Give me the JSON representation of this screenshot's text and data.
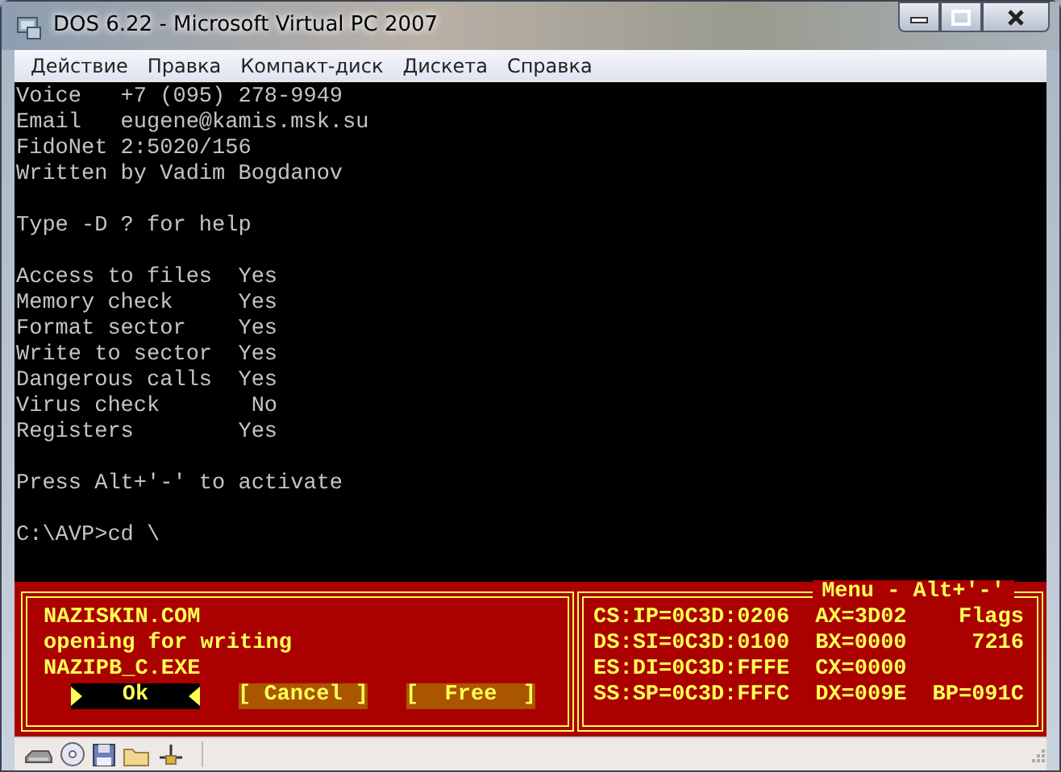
{
  "window": {
    "title": "DOS 6.22 - Microsoft Virtual PC 2007"
  },
  "menu": [
    "Действие",
    "Правка",
    "Компакт-диск",
    "Дискета",
    "Справка"
  ],
  "console": [
    {
      "kind": "text",
      "text": "Voice   +7 (095) 278-9949"
    },
    {
      "kind": "text",
      "text": "Email   eugene@kamis.msk.su"
    },
    {
      "kind": "text",
      "text": "FidoNet 2:5020/156"
    },
    {
      "kind": "text",
      "text": "Written by Vadim Bogdanov"
    },
    {
      "kind": "blank"
    },
    {
      "kind": "text",
      "text": "Type -D ? for help"
    },
    {
      "kind": "blank"
    },
    {
      "kind": "option",
      "label": "Access to files",
      "value": "Yes"
    },
    {
      "kind": "option",
      "label": "Memory check",
      "value": "Yes"
    },
    {
      "kind": "option",
      "label": "Format sector",
      "value": "Yes"
    },
    {
      "kind": "option",
      "label": "Write to sector",
      "value": "Yes"
    },
    {
      "kind": "option",
      "label": "Dangerous calls",
      "value": "Yes"
    },
    {
      "kind": "option",
      "label": "Virus check",
      "value": "No"
    },
    {
      "kind": "option",
      "label": "Registers",
      "value": "Yes"
    },
    {
      "kind": "blank"
    },
    {
      "kind": "text",
      "text": "Press Alt+'-' to activate"
    },
    {
      "kind": "blank"
    },
    {
      "kind": "text",
      "text": "C:\\AVP>cd \\"
    }
  ],
  "dialog": {
    "messages": [
      "NAZISKIN.COM",
      "opening for writing",
      "NAZIPB_C.EXE"
    ],
    "buttons": [
      {
        "label": "Ok",
        "selected": true
      },
      {
        "label": "[ Cancel ]",
        "selected": false
      },
      {
        "label": "[  Free  ]",
        "selected": false
      }
    ]
  },
  "registers": {
    "title": "Menu - Alt+'-'",
    "rows": [
      [
        "CS:IP=0C3D:0206",
        "AX=3D02",
        "Flags"
      ],
      [
        "DS:SI=0C3D:0100",
        "BX=0000",
        "7216"
      ],
      [
        "ES:DI=0C3D:FFFE",
        "CX=0000",
        null
      ],
      [
        "SS:SP=0C3D:FFFC",
        "DX=009E",
        "BP=091C"
      ]
    ]
  }
}
